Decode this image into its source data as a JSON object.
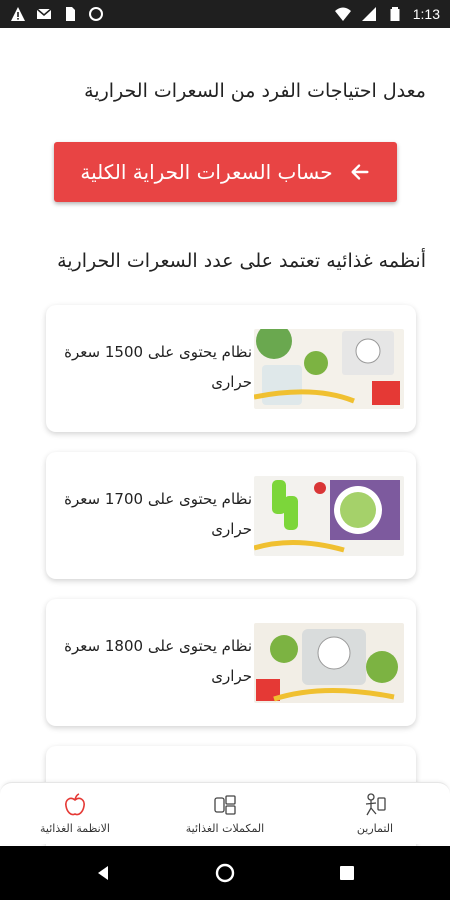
{
  "status_bar": {
    "time": "1:13",
    "icons": [
      "warning-icon",
      "gmail-icon",
      "sim-icon",
      "circle-icon",
      "wifi-icon",
      "signal-icon",
      "battery-icon"
    ]
  },
  "main": {
    "calorie_needs_title": "معدل احتياجات الفرد من السعرات الحرارية",
    "calc_button_label": "حساب السعرات الحراية الكلية",
    "diets_title": "أنظمه غذائيه تعتمد على عدد السعرات الحرارية",
    "diets": [
      {
        "label": "نظام يحتوى على 1500 سعرة حرارى",
        "image": "diet-photo-scale-apple"
      },
      {
        "label": "نظام يحتوى على 1700 سعرة حرارى",
        "image": "diet-photo-dumbbells-salad"
      },
      {
        "label": "نظام يحتوى على 1800 سعرة حرارى",
        "image": "diet-photo-apples-scale"
      }
    ]
  },
  "bottom_nav": {
    "items": [
      {
        "label": "الانظمة الغذائية",
        "icon": "apple-icon"
      },
      {
        "label": "المكملات الغذائية",
        "icon": "supplements-icon"
      },
      {
        "label": "التمارين",
        "icon": "exercise-icon"
      }
    ]
  },
  "colors": {
    "accent": "#e84444",
    "status_bar": "#1f1f1f",
    "system_nav": "#000000"
  }
}
